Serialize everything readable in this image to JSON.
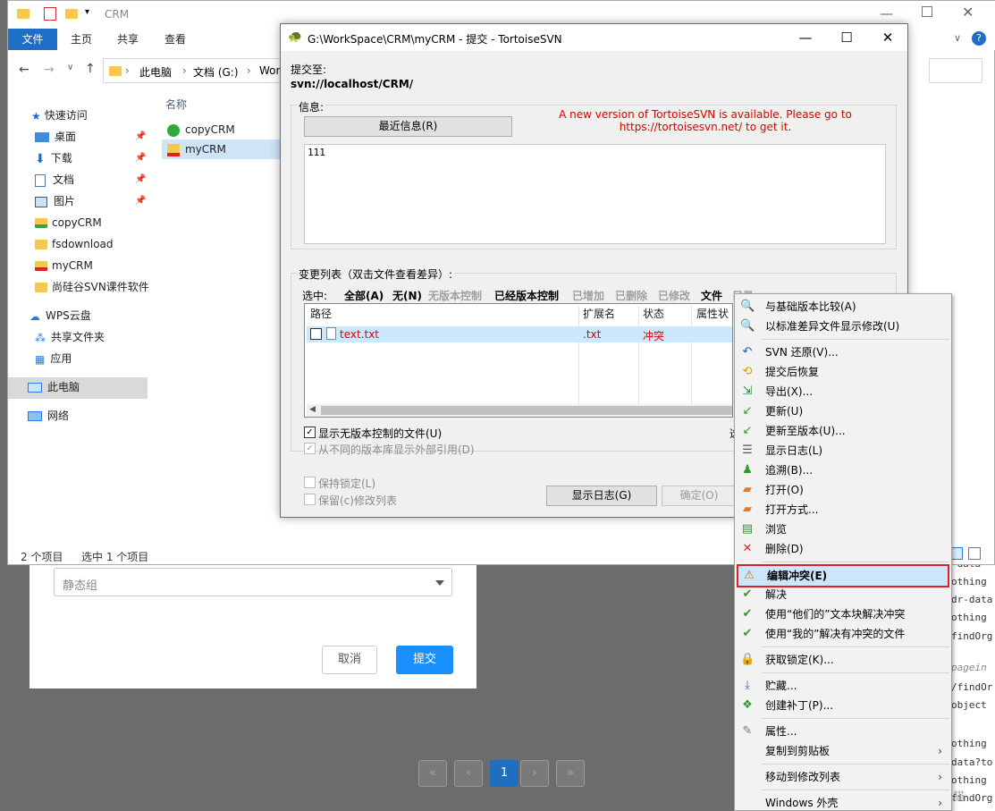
{
  "explorer": {
    "title": "CRM",
    "ribbon_tabs": [
      "文件",
      "主页",
      "共享",
      "查看"
    ],
    "breadcrumb": [
      "此电脑",
      "文档 (G:)",
      "Wor"
    ],
    "sidebar": [
      {
        "label": "快速访问",
        "pinned": false
      },
      {
        "label": "桌面",
        "pinned": true
      },
      {
        "label": "下载",
        "pinned": true
      },
      {
        "label": "文档",
        "pinned": true
      },
      {
        "label": "图片",
        "pinned": true
      },
      {
        "label": "copyCRM",
        "pinned": false
      },
      {
        "label": "fsdownload",
        "pinned": false
      },
      {
        "label": "myCRM",
        "pinned": false
      },
      {
        "label": "尚硅谷SVN课件软件",
        "pinned": false
      },
      {
        "label": "WPS云盘",
        "pinned": false
      },
      {
        "label": "共享文件夹",
        "pinned": false
      },
      {
        "label": "应用",
        "pinned": false
      },
      {
        "label": "此电脑",
        "pinned": false
      },
      {
        "label": "网络",
        "pinned": false
      }
    ],
    "column_name": "名称",
    "files": [
      "copyCRM",
      "myCRM"
    ],
    "status_items": "2 个项目",
    "status_selected": "选中 1 个项目"
  },
  "dialog": {
    "title": "G:\\WorkSpace\\CRM\\myCRM - 提交 - TortoiseSVN",
    "commit_to_label": "提交至:",
    "commit_url": "svn://localhost/CRM/",
    "message_group": "信息:",
    "recent_messages_btn": "最近信息(R)",
    "update_notice_1": "A new version of TortoiseSVN is available. Please go to",
    "update_notice_2": "https://tortoisesvn.net/ to get it.",
    "message_text": "111",
    "changes_group": "变更列表（双击文件查看差异）:",
    "select_label": "选中:",
    "select_links": [
      {
        "label": "全部(A)",
        "enabled": true
      },
      {
        "label": "无(N)",
        "enabled": true
      },
      {
        "label": "无版本控制",
        "enabled": false
      },
      {
        "label": "已经版本控制",
        "enabled": true
      },
      {
        "label": "已增加",
        "enabled": false
      },
      {
        "label": "已删除",
        "enabled": false
      },
      {
        "label": "已修改",
        "enabled": false
      },
      {
        "label": "文件",
        "enabled": true
      },
      {
        "label": "目录",
        "enabled": false
      }
    ],
    "columns": [
      "路径",
      "扩展名",
      "状态",
      "属性状态"
    ],
    "rows": [
      {
        "path": "text.txt",
        "ext": ".txt",
        "status": "冲突"
      }
    ],
    "show_unversioned": "显示无版本控制的文件(U)",
    "show_externals": "从不同的版本库显示外部引用(D)",
    "keep_locks": "保持锁定(L)",
    "keep_changelists": "保留(c)修改列表",
    "show_log_btn": "显示日志(G)",
    "ok_btn": "确定(O)",
    "partial_right_label": "选"
  },
  "context_menu": [
    {
      "label": "与基础版本比较(A)",
      "icon": "magnifier-icon",
      "sep_before": false
    },
    {
      "label": "以标准差异文件显示修改(U)",
      "icon": "magnifier-icon",
      "sep_before": false
    },
    {
      "label": "SVN 还原(V)...",
      "icon": "undo-icon",
      "sep_before": true
    },
    {
      "label": "提交后恢复",
      "icon": "restore-icon",
      "sep_before": false
    },
    {
      "label": "导出(X)...",
      "icon": "export-icon",
      "sep_before": false
    },
    {
      "label": "更新(U)",
      "icon": "update-icon",
      "sep_before": false
    },
    {
      "label": "更新至版本(U)...",
      "icon": "update-icon",
      "sep_before": false
    },
    {
      "label": "显示日志(L)",
      "icon": "log-icon",
      "sep_before": false
    },
    {
      "label": "追溯(B)...",
      "icon": "blame-icon",
      "sep_before": false
    },
    {
      "label": "打开(O)",
      "icon": "open-icon",
      "sep_before": false
    },
    {
      "label": "打开方式...",
      "icon": "open-icon",
      "sep_before": false
    },
    {
      "label": "浏览",
      "icon": "browse-icon",
      "sep_before": false
    },
    {
      "label": "删除(D)",
      "icon": "delete-icon",
      "sep_before": false
    },
    {
      "label": "编辑冲突(E)",
      "icon": "edit-conflict-icon",
      "sep_before": true,
      "highlighted": true
    },
    {
      "label": "解决",
      "icon": "resolve-icon",
      "sep_before": false
    },
    {
      "label": "使用“他们的”文本块解决冲突",
      "icon": "resolve-icon",
      "sep_before": false
    },
    {
      "label": "使用“我的”解决有冲突的文件",
      "icon": "resolve-icon",
      "sep_before": false
    },
    {
      "label": "获取锁定(K)...",
      "icon": "lock-icon",
      "sep_before": true
    },
    {
      "label": "贮藏...",
      "icon": "shelve-icon",
      "sep_before": true
    },
    {
      "label": "创建补丁(P)...",
      "icon": "patch-icon",
      "sep_before": false
    },
    {
      "label": "属性...",
      "icon": "properties-icon",
      "sep_before": true
    },
    {
      "label": "复制到剪贴板",
      "icon": "",
      "sep_before": false,
      "submenu": true
    },
    {
      "label": "移动到修改列表",
      "icon": "",
      "sep_before": true,
      "submenu": true
    },
    {
      "label": "Windows 外壳",
      "icon": "",
      "sep_before": true,
      "submenu": true
    }
  ],
  "web": {
    "select_placeholder": "静态组",
    "cancel_btn": "取消",
    "submit_btn": "提交",
    "current_page": "1",
    "code_lines": [
      "-data",
      "othing",
      "dr-data",
      "othing",
      "findOrg",
      "pagein",
      "/findOr",
      "object",
      "othing",
      "data?to",
      "othing",
      "findOrg"
    ]
  },
  "watermark": "CSDN @刘未猫"
}
